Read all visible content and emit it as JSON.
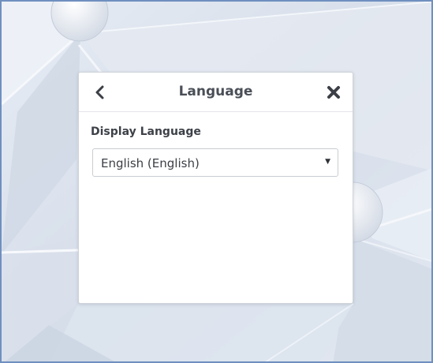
{
  "dialog": {
    "title": "Language",
    "back_icon": "chevron-left-icon",
    "close_icon": "close-icon",
    "display_language_label": "Display Language",
    "display_language_value": "English (English)",
    "select_arrow_icon": "caret-down-icon"
  },
  "colors": {
    "frame_border": "#6f8fbf",
    "background": "#dbe3ef",
    "title_text": "#4a4f57",
    "icon": "#3c4046"
  }
}
